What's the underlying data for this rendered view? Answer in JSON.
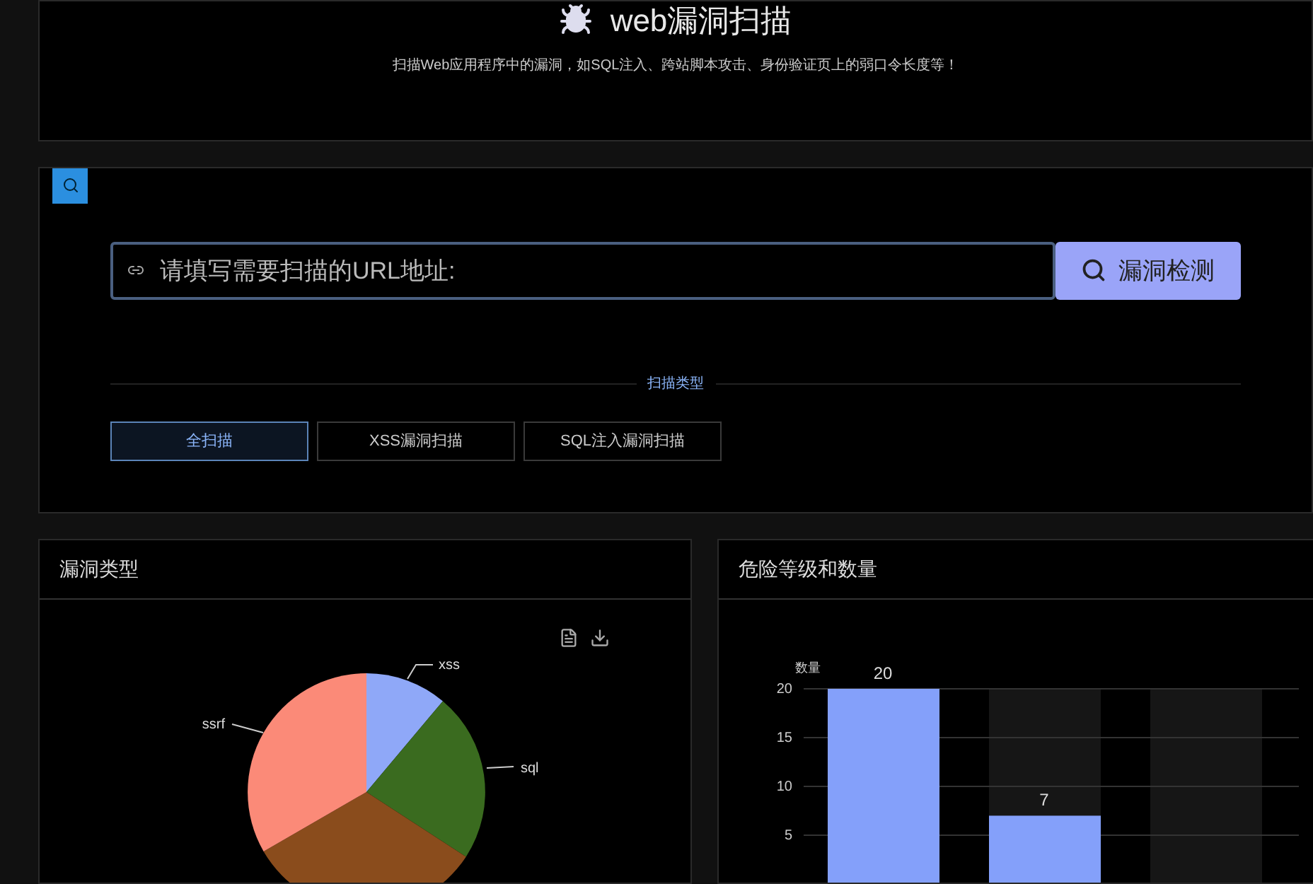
{
  "header": {
    "title": "web漏洞扫描",
    "subtitle": "扫描Web应用程序中的漏洞，如SQL注入、跨站脚本攻击、身份验证页上的弱口令长度等！"
  },
  "scan": {
    "url_field": {
      "placeholder": "请填写需要扫描的URL地址:"
    },
    "submit_button": "漏洞检测",
    "divider_label": "扫描类型",
    "scan_types": [
      {
        "label": "全扫描",
        "selected": true
      },
      {
        "label": "XSS漏洞扫描",
        "selected": false
      },
      {
        "label": "SQL注入漏洞扫描",
        "selected": false
      }
    ]
  },
  "vuln_type_panel": {
    "title": "漏洞类型",
    "slices": [
      {
        "label": "xss",
        "color": "#8fa8f8"
      },
      {
        "label": "sql",
        "color": "#3a6b1f"
      },
      {
        "color": "#8a4c1c"
      },
      {
        "label": "ssrf",
        "color": "#fb8a78"
      }
    ]
  },
  "risk_panel": {
    "title": "危险等级和数量",
    "chart_data": {
      "type": "bar",
      "ylabel": "数量",
      "series": [
        {
          "color": "#84a0fa",
          "values": [
            20,
            7,
            null
          ]
        },
        {
          "color": "#161616",
          "values": [
            null,
            20,
            20
          ]
        }
      ],
      "ylim": [
        0,
        20
      ],
      "yticks": [
        5,
        10,
        15,
        20
      ],
      "grid": true,
      "value_labels": [
        "20",
        "7",
        null
      ]
    }
  }
}
